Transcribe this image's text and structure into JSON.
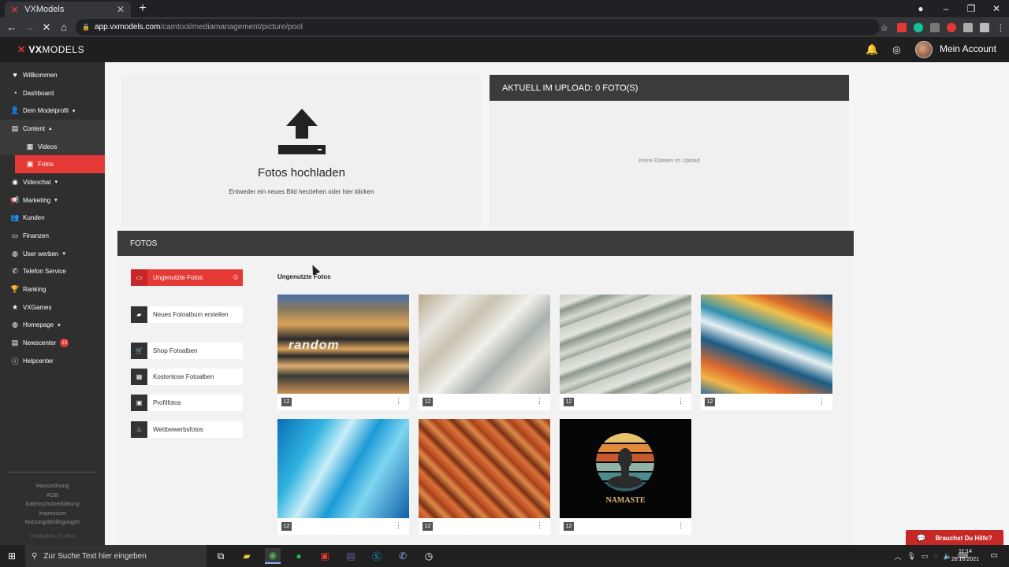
{
  "browser": {
    "tab_title": "VXModels",
    "tab_close": "✕",
    "new_tab": "+",
    "url_host": "app.vxmodels.com",
    "url_path": "/camtool/mediamanagement/picture/pool"
  },
  "header": {
    "logo_vx": "VX",
    "logo_rest": "MODELS",
    "account_label": "Mein Account"
  },
  "sidebar": {
    "items": [
      {
        "label": "Willkommen",
        "icon": "heart-icon"
      },
      {
        "label": "Dashboard",
        "icon": "gauge-icon"
      },
      {
        "label": "Dein Modelprofil",
        "icon": "user-icon"
      },
      {
        "label": "Content",
        "icon": "film-icon"
      },
      {
        "label": "Videos",
        "icon": "video-icon"
      },
      {
        "label": "Fotos",
        "icon": "photo-icon"
      },
      {
        "label": "Videochat",
        "icon": "webcam-icon"
      },
      {
        "label": "Marketing",
        "icon": "megaphone-icon"
      },
      {
        "label": "Kunden",
        "icon": "users-icon"
      },
      {
        "label": "Finanzen",
        "icon": "money-icon"
      },
      {
        "label": "User werben",
        "icon": "globe-icon"
      },
      {
        "label": "Telefon Service",
        "icon": "phone-icon"
      },
      {
        "label": "Ranking",
        "icon": "trophy-icon"
      },
      {
        "label": "VXGames",
        "icon": "star-icon"
      },
      {
        "label": "Homepage",
        "icon": "globe-icon"
      },
      {
        "label": "Newscenter",
        "icon": "news-icon",
        "badge": "13"
      },
      {
        "label": "Helpcenter",
        "icon": "info-icon"
      }
    ],
    "footer": {
      "links": [
        "Hausordnung",
        "AGB",
        "Datenschutzerklärung",
        "Impressum",
        "Nutzungsbedingungen"
      ],
      "version": "VXModels v1.45.0"
    }
  },
  "upload": {
    "title": "Fotos hochladen",
    "subtitle": "Entweder ein neues Bild herziehen oder hier klicken"
  },
  "queue": {
    "title": "AKTUELL IM UPLOAD: 0 FOTO(S)",
    "empty_text": "Keine Dateien im Upload"
  },
  "fotos": {
    "title": "FOTOS",
    "grid_title": "Ungenutzte Fotos",
    "buttons": [
      {
        "label": "Ungenutzte Fotos"
      },
      {
        "label": "Neues Fotoalbum erstellen"
      },
      {
        "label": "Shop Fotoalben"
      },
      {
        "label": "Kostenlose Fotoalben"
      },
      {
        "label": "Profilfotos"
      },
      {
        "label": "Wettbewerbsfotos"
      }
    ],
    "photos": [
      {
        "count": "12",
        "subject": "books-with-random-text"
      },
      {
        "count": "12",
        "subject": "white-paint-texture"
      },
      {
        "count": "12",
        "subject": "dollar-bills"
      },
      {
        "count": "12",
        "subject": "fluid-art-paint"
      },
      {
        "count": "12",
        "subject": "blue-water-texture"
      },
      {
        "count": "12",
        "subject": "autumn-leaves"
      },
      {
        "count": "12",
        "subject": "namaste-yoga-silhouette"
      }
    ],
    "photo_overlay": {
      "books_text": "random",
      "namaste_text": "NAMASTE"
    }
  },
  "help_button": "Brauchst Du Hilfe?",
  "taskbar": {
    "search_placeholder": "Zur Suche Text hier eingeben",
    "time": "11:14",
    "date": "28.10.2021"
  },
  "colors": {
    "accent": "#e53935",
    "dark": "#2f2f2f",
    "header": "#3b3b3b"
  }
}
